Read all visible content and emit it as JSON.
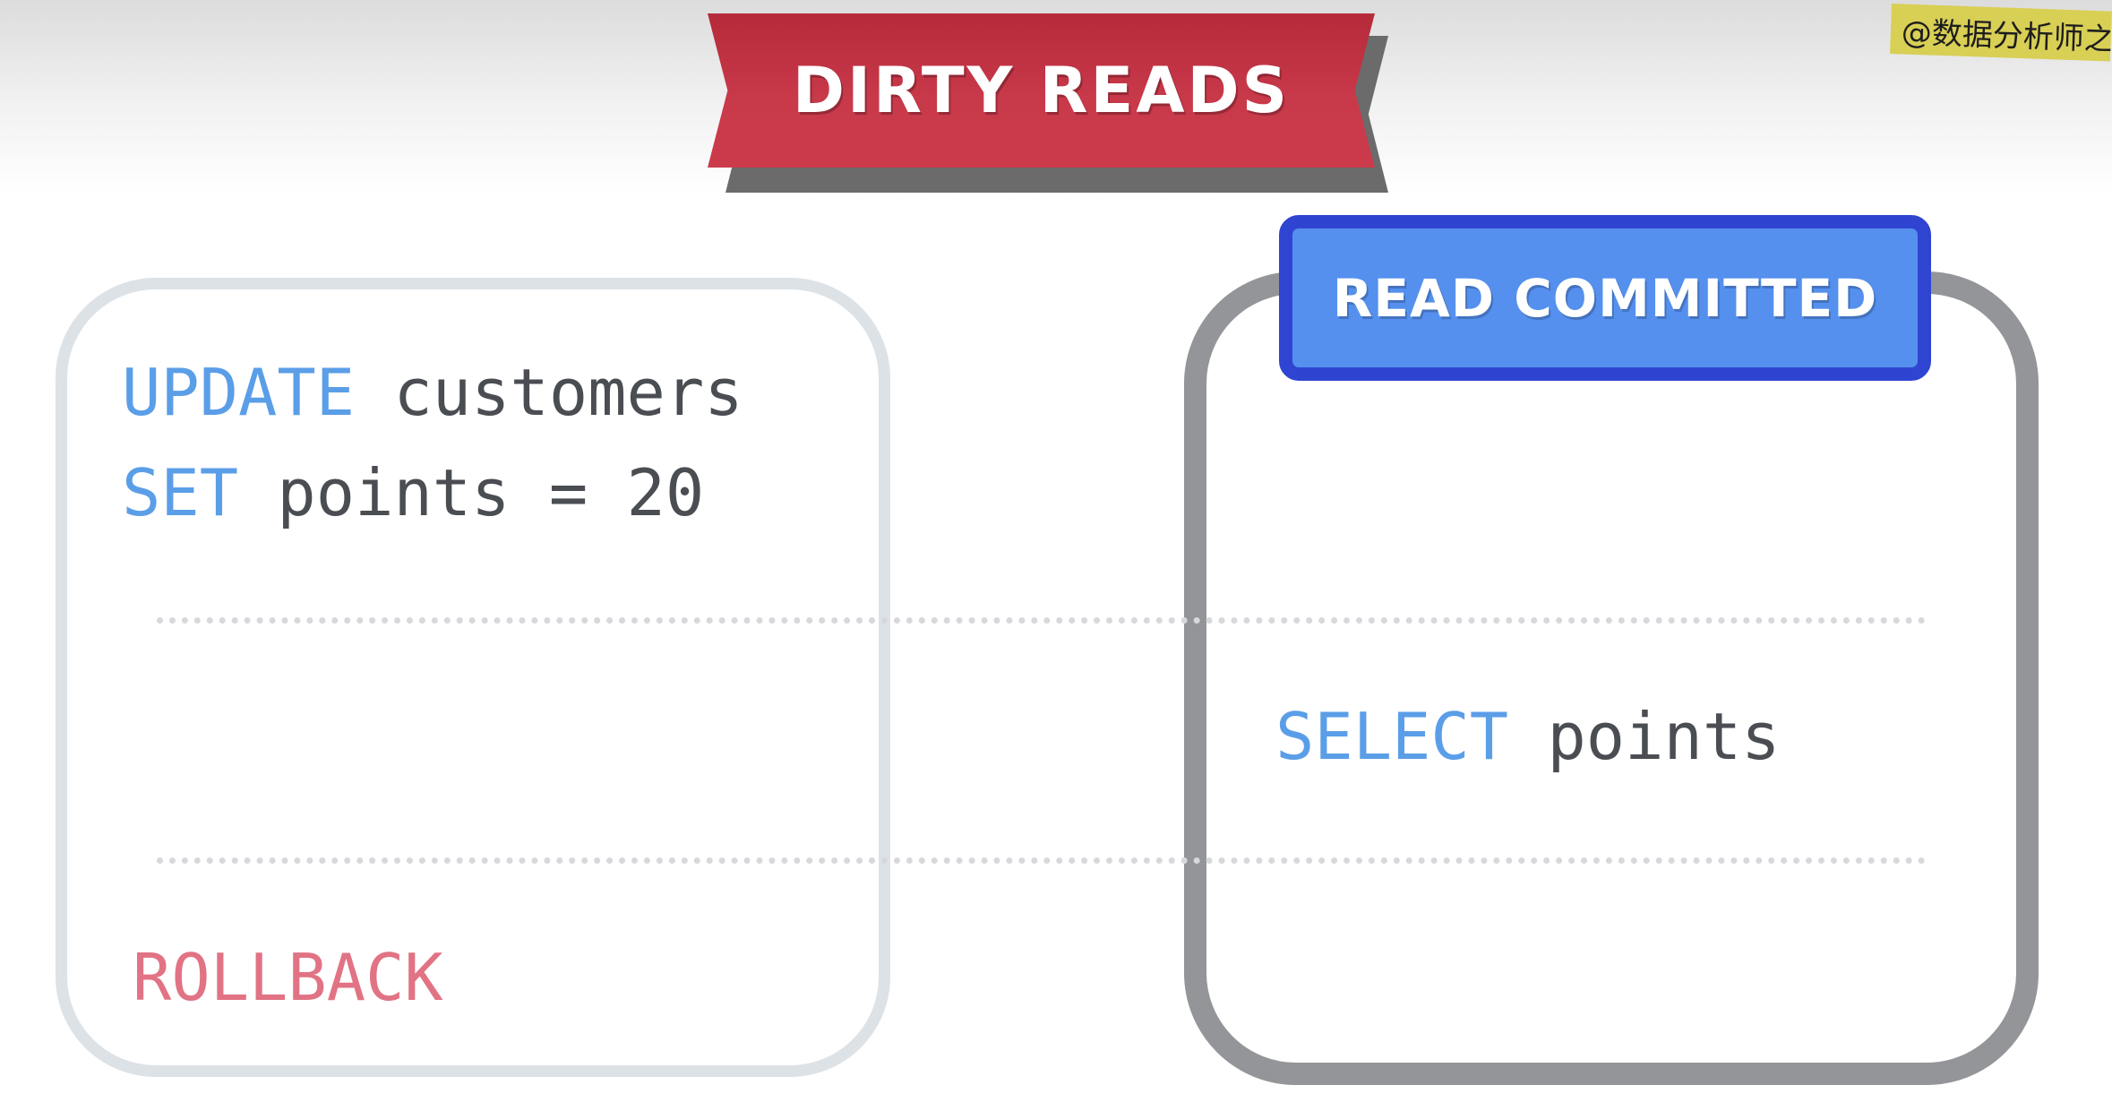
{
  "title": "DIRTY READS",
  "watermark": "@数据分析师之",
  "badge": {
    "label": "READ COMMITTED"
  },
  "transaction_a": {
    "lines": [
      {
        "keyword": "UPDATE",
        "text": " customers"
      },
      {
        "keyword": "SET",
        "text": " points = 20"
      }
    ],
    "rollback": "ROLLBACK"
  },
  "transaction_b": {
    "lines": [
      {
        "keyword": "SELECT",
        "text": " points"
      }
    ]
  },
  "colors": {
    "ribbon": "#c8394a",
    "badge_fill": "#5590ee",
    "badge_border": "#2f45d1",
    "keyword": "#5b9ee8",
    "rollback": "#e17384",
    "code_text": "#4a4d52"
  }
}
